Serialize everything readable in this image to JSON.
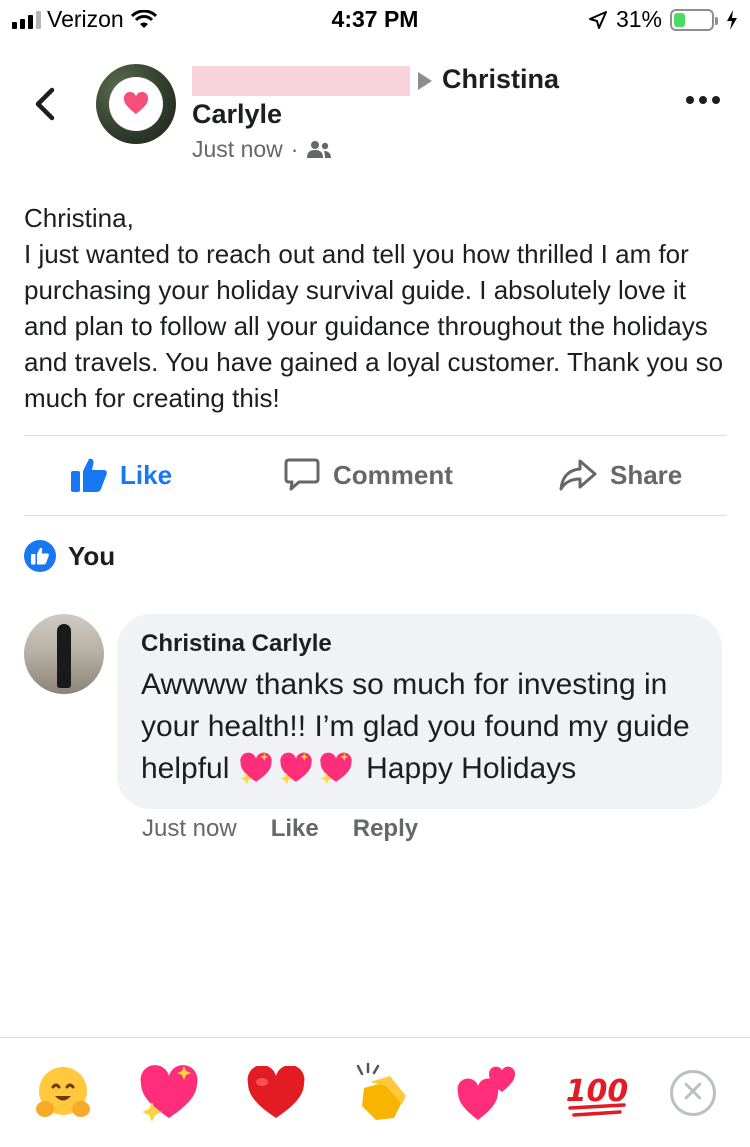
{
  "status_bar": {
    "carrier": "Verizon",
    "time": "4:37 PM",
    "battery_percent": "31%",
    "battery_level": 0.31
  },
  "post": {
    "author_redacted": true,
    "recipient_name": "Christina",
    "recipient_name_line2": "Carlyle",
    "timestamp": "Just now",
    "audience_icon": "friends-icon",
    "body_lines": [
      "Christina,",
      "I just wanted to reach out and tell you how thrilled I am for purchasing your holiday survival guide. I absolutely love it and plan to follow all your guidance throughout the holidays and travels. You have gained a loyal customer. Thank you so much for creating this!"
    ]
  },
  "actions": {
    "like_label": "Like",
    "comment_label": "Comment",
    "share_label": "Share"
  },
  "reactions": {
    "liked_by": "You"
  },
  "comment": {
    "author": "Christina Carlyle",
    "text_before": "Awwww thanks so much for investing in your health!!  I’m glad you found my guide helpful",
    "text_after": "Happy Holidays",
    "emoji_count": 3,
    "timestamp": "Just now",
    "like_label": "Like",
    "reply_label": "Reply"
  },
  "reaction_tray": {
    "items": [
      "hugging-face-emoji",
      "sparkling-heart-emoji",
      "red-heart-emoji",
      "clapping-hands-emoji",
      "two-hearts-emoji",
      "hundred-points-emoji"
    ],
    "close_icon": "close-icon",
    "hundred_text": "100"
  },
  "colors": {
    "accent": "#1877f2",
    "secondary_text": "#65676b",
    "bubble": "#f0f2f5",
    "heart_pink": "#ff2d7a"
  }
}
